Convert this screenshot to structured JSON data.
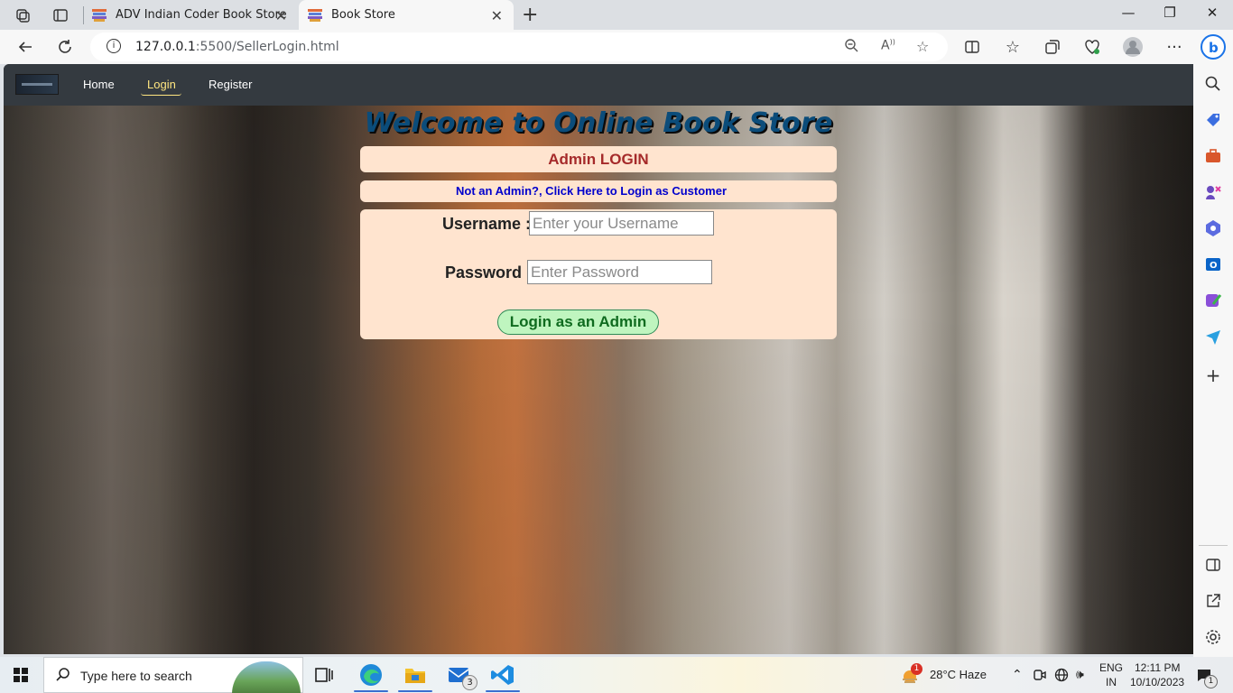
{
  "browser": {
    "tabs": [
      {
        "title": "ADV Indian Coder Book Store",
        "active": false
      },
      {
        "title": "Book Store",
        "active": true
      }
    ],
    "url_host": "127.0.0.1",
    "url_path": ":5500/SellerLogin.html"
  },
  "navbar": {
    "links": [
      "Home",
      "Login",
      "Register"
    ],
    "active": "Login"
  },
  "page": {
    "heading": "Welcome to Online Book Store",
    "panel_title": "Admin LOGIN",
    "customer_link": "Not an Admin?, Click Here to Login as Customer",
    "username_label": "Username :",
    "username_placeholder": "Enter your Username",
    "password_label": "Password :",
    "password_placeholder": "Enter Password",
    "submit_label": "Login as an Admin"
  },
  "taskbar": {
    "search_placeholder": "Type here to search",
    "mail_badge": "3",
    "weather_alert": "1",
    "weather": "28°C  Haze",
    "lang_top": "ENG",
    "lang_bottom": "IN",
    "time": "12:11 PM",
    "date": "10/10/2023",
    "notif_badge": "1"
  },
  "icons": [
    "workspaces-icon",
    "tab-actions-icon",
    "back-icon",
    "refresh-icon",
    "site-info-icon",
    "zoom-out-icon",
    "read-aloud-icon",
    "favorite-star-icon",
    "split-screen-icon",
    "favorites-icon",
    "collections-icon",
    "browser-essentials-icon",
    "profile-avatar-icon",
    "more-menu-icon",
    "copilot-icon"
  ],
  "colors": {
    "navbar_bg": "#343a40",
    "card_bg": "#ffe4cf",
    "heading": "#0b4c7a",
    "panel_title": "#a52a2a",
    "link": "#0000cd",
    "button_bg": "#bff5bf",
    "button_text": "#0f6b1f"
  }
}
